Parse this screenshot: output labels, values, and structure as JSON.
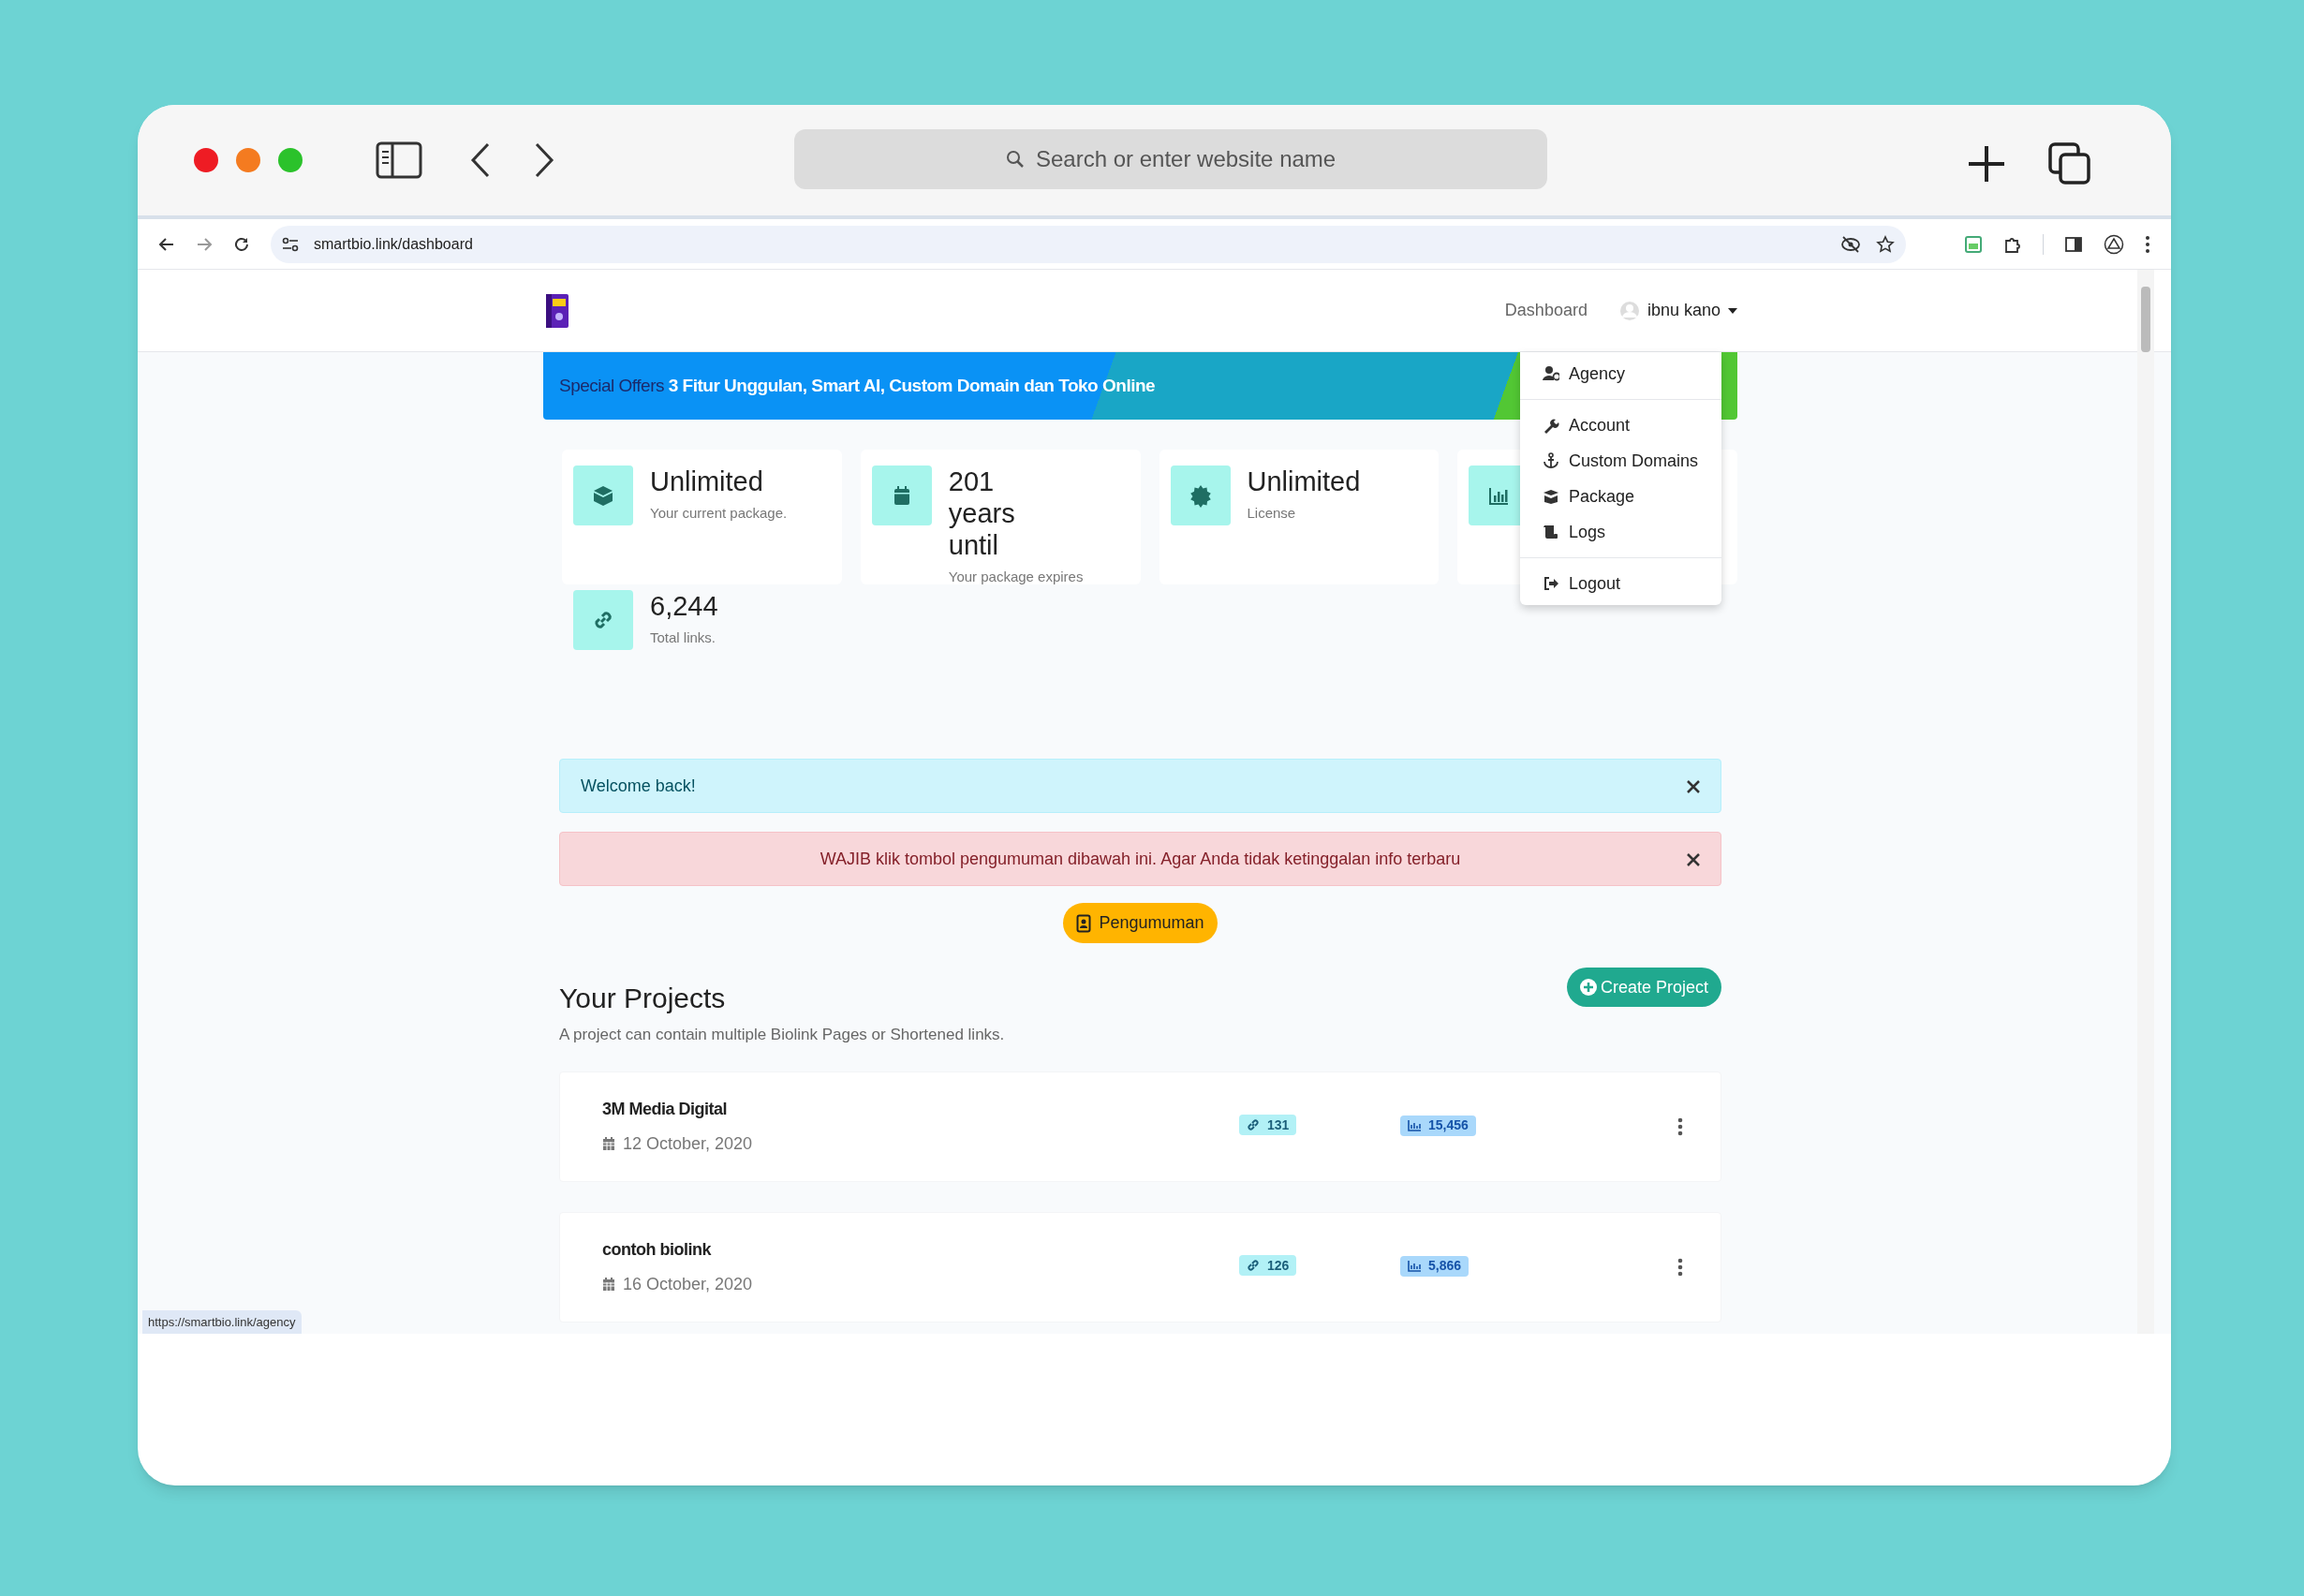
{
  "browser": {
    "search_placeholder": "Search or enter website name",
    "url": "smartbio.link/dashboard",
    "status_url": "https://smartbio.link/agency"
  },
  "header": {
    "nav_link": "Dashboard",
    "user": "ibnu kano"
  },
  "dropdown": {
    "expanded": true,
    "groups": [
      [
        "Agency"
      ],
      [
        "Account",
        "Custom Domains",
        "Package",
        "Logs"
      ],
      [
        "Logout"
      ]
    ]
  },
  "banner": {
    "lead": "Special Offers",
    "text": "3 Fitur Unggulan, Smart AI, Custom Domain dan Toko Online"
  },
  "stats": [
    {
      "value": "Unlimited",
      "caption": "Your current package."
    },
    {
      "value": "201 years until",
      "caption": "Your package expires"
    },
    {
      "value": "Unlimited",
      "caption": "License"
    },
    {
      "value": "6,244",
      "caption": "Total links."
    }
  ],
  "alerts": [
    {
      "kind": "info",
      "text": "Welcome back!"
    },
    {
      "kind": "danger",
      "text": "WAJIB klik tombol pengumuman dibawah ini. Agar Anda tidak ketinggalan info terbaru"
    }
  ],
  "announcement_button": "Pengumuman",
  "projects": {
    "title": "Your Projects",
    "description": "A project can contain multiple Biolink Pages or Shortened links.",
    "create_button": "Create Project",
    "items": [
      {
        "name": "3M Media Digital",
        "date": "12 October, 2020",
        "links": "131",
        "clicks": "15,456"
      },
      {
        "name": "contoh biolink",
        "date": "16 October, 2020",
        "links": "126",
        "clicks": "5,866"
      }
    ]
  }
}
